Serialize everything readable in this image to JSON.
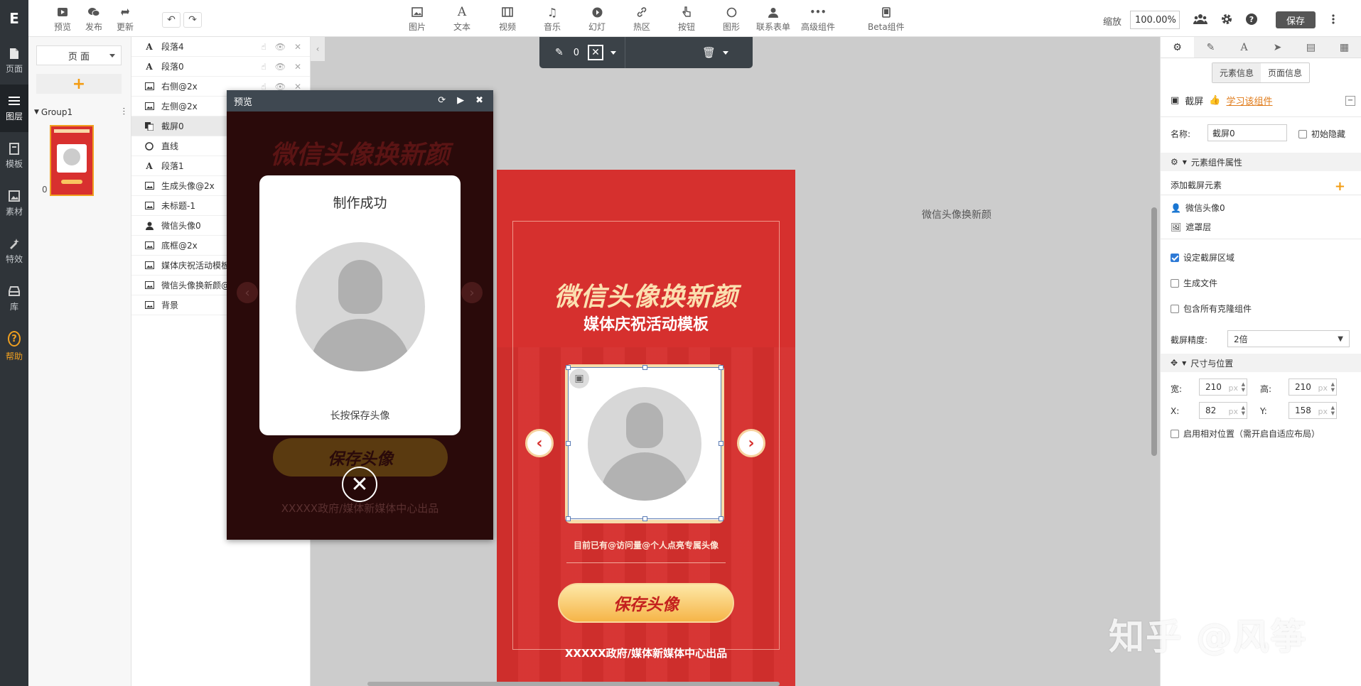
{
  "leftnav": {
    "logo": "E",
    "items": [
      {
        "label": "页面",
        "icon": "page-icon"
      },
      {
        "label": "图层",
        "icon": "layers-icon"
      },
      {
        "label": "模板",
        "icon": "template-icon"
      },
      {
        "label": "素材",
        "icon": "image-icon"
      },
      {
        "label": "特效",
        "icon": "effects-icon"
      },
      {
        "label": "库",
        "icon": "library-icon"
      },
      {
        "label": "帮助",
        "icon": "help-icon"
      }
    ]
  },
  "toolbar": {
    "left": [
      "预览",
      "发布",
      "更新"
    ],
    "tools": [
      "图片",
      "文本",
      "视频",
      "音乐",
      "幻灯",
      "热区",
      "按钮",
      "图形",
      "联系表单",
      "高级组件",
      "Beta组件"
    ],
    "zoom_label": "缩放",
    "zoom_value": "100.00%",
    "save_label": "保存"
  },
  "pages_panel": {
    "page_select": "页 面",
    "group_name": "Group1",
    "thumb_index": "0"
  },
  "layers": [
    {
      "name": "段落4",
      "icon": "text-icon"
    },
    {
      "name": "段落0",
      "icon": "text-icon"
    },
    {
      "name": "右侧@2x",
      "icon": "image-icon"
    },
    {
      "name": "左侧@2x",
      "icon": "image-icon"
    },
    {
      "name": "截屏0",
      "icon": "screenshot-icon"
    },
    {
      "name": "直线",
      "icon": "circle-icon"
    },
    {
      "name": "段落1",
      "icon": "text-icon"
    },
    {
      "name": "生成头像@2x",
      "icon": "image-icon"
    },
    {
      "name": "未标题-1",
      "icon": "image-icon"
    },
    {
      "name": "微信头像0",
      "icon": "user-icon"
    },
    {
      "name": "底框@2x",
      "icon": "image-icon"
    },
    {
      "name": "媒体庆祝活动模板",
      "icon": "image-icon"
    },
    {
      "name": "微信头像换新颜@2x",
      "icon": "image-icon"
    },
    {
      "name": "背景",
      "icon": "image-icon"
    }
  ],
  "canvas": {
    "float_bar_num": "0",
    "side_label": "微信头像换新颜",
    "phone": {
      "title": "微信头像换新颜",
      "subtitle": "媒体庆祝活动模板",
      "visit_text": "目前已有@访问量@个人点亮专属头像",
      "save_button": "保存头像",
      "credit": "XXXXX政府/媒体新媒体中心出品"
    }
  },
  "preview": {
    "title": "预览",
    "bg_title": "微信头像换新颜",
    "card_title": "制作成功",
    "card_hint": "长按保存头像",
    "save_button": "保存头像",
    "credit": "XXXXX政府/媒体新媒体中心出品"
  },
  "right_panel": {
    "tabs": [
      "gear-icon",
      "pen-icon",
      "font-icon",
      "send-icon",
      "doc-icon",
      "grid-icon"
    ],
    "seg": [
      "元素信息",
      "页面信息"
    ],
    "component_name": "截屏",
    "learn_link": "学习该组件",
    "name_label": "名称:",
    "name_value": "截屏0",
    "initial_hidden": "初始隐藏",
    "section_props": "元素组件属性",
    "add_element": "添加截屏元素",
    "elements": [
      "微信头像0",
      "遮罩层"
    ],
    "set_area": "设定截屏区域",
    "gen_file": "生成文件",
    "include_clone": "包含所有克隆组件",
    "precision_label": "截屏精度:",
    "precision_value": "2倍",
    "section_size": "尺寸与位置",
    "width_label": "宽:",
    "width_value": "210",
    "height_label": "高:",
    "height_value": "210",
    "x_label": "X:",
    "x_value": "82",
    "y_label": "Y:",
    "y_value": "158",
    "unit": "px",
    "relative_pos": "启用相对位置（需开启自适应布局）",
    "set_area_checked": true
  },
  "watermark": "知乎 @风筝"
}
